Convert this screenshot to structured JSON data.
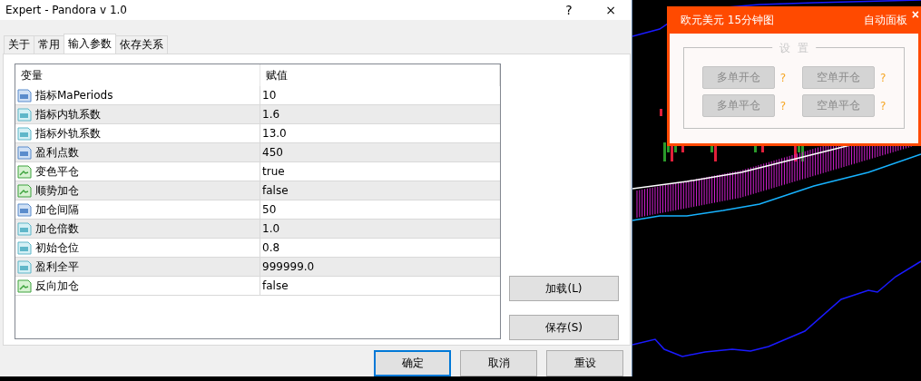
{
  "window": {
    "title": "Expert - Pandora v 1.0",
    "help": "?",
    "close": "×"
  },
  "tabs": [
    {
      "label": "关于",
      "selected": false
    },
    {
      "label": "常用",
      "selected": false
    },
    {
      "label": "输入参数",
      "selected": true
    },
    {
      "label": "依存关系",
      "selected": false
    }
  ],
  "table": {
    "columns": [
      "变量",
      "赋值"
    ],
    "rows": [
      {
        "kind": "int",
        "name": "指标MaPeriods",
        "value": "10"
      },
      {
        "kind": "double",
        "name": "指标内轨系数",
        "value": "1.6"
      },
      {
        "kind": "double",
        "name": "指标外轨系数",
        "value": "13.0"
      },
      {
        "kind": "int",
        "name": "盈利点数",
        "value": "450"
      },
      {
        "kind": "bool",
        "name": "变色平仓",
        "value": "true"
      },
      {
        "kind": "bool",
        "name": "顺势加仓",
        "value": "false"
      },
      {
        "kind": "int",
        "name": "加仓间隔",
        "value": "50"
      },
      {
        "kind": "double",
        "name": "加仓倍数",
        "value": "1.0"
      },
      {
        "kind": "double",
        "name": "初始仓位",
        "value": "0.8"
      },
      {
        "kind": "double",
        "name": "盈利全平",
        "value": "999999.0"
      },
      {
        "kind": "bool",
        "name": "反向加仓",
        "value": "false"
      }
    ]
  },
  "side_buttons": [
    "加载(L)",
    "保存(S)"
  ],
  "buttons": [
    {
      "label": "确定",
      "selected": true
    },
    {
      "label": "取消",
      "selected": false
    },
    {
      "label": "重设",
      "selected": false
    }
  ],
  "panel": {
    "title": "欧元美元 15分钟图",
    "mode": "自动面板",
    "close": "×",
    "group": "设  置",
    "buttons": [
      {
        "label": "多单开仓",
        "disabled": true,
        "help": "?"
      },
      {
        "label": "空单开仓",
        "disabled": true,
        "help": "?"
      },
      {
        "label": "多单平仓",
        "disabled": true,
        "help": "?"
      },
      {
        "label": "空单平仓",
        "disabled": true,
        "help": "?"
      }
    ]
  }
}
